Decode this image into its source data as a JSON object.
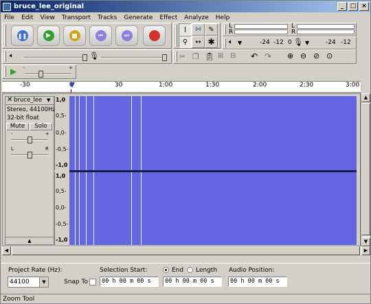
{
  "window": {
    "title": "bruce_lee_original"
  },
  "menu": [
    "File",
    "Edit",
    "View",
    "Transport",
    "Tracks",
    "Generate",
    "Effect",
    "Analyze",
    "Help"
  ],
  "meters": {
    "L": "L",
    "R": "R",
    "scale_a": "-24",
    "scale_b": "-12",
    "scale_c": "0",
    "scale_d": "-24",
    "scale_e": "-12"
  },
  "ruler": {
    "ticks": [
      "-30",
      "0",
      "30",
      "1:00",
      "1:30",
      "2:00",
      "2:30",
      "3:00"
    ]
  },
  "track": {
    "name": "bruce_lee",
    "info1": "Stereo, 44100Hz",
    "info2": "32-bit float",
    "mute": "Mute",
    "solo": "Solo",
    "gain_minus": "-",
    "gain_plus": "+",
    "pan_l": "L",
    "pan_r": "R",
    "scale": [
      "1,0",
      "0,5-",
      "0,0-",
      "-0,5-",
      "-1,0"
    ]
  },
  "bottom": {
    "project_rate_label": "Project Rate (Hz):",
    "project_rate_value": "44100",
    "snap_to": "Snap To",
    "selection_start_label": "Selection Start:",
    "end_label": "End",
    "length_label": "Length",
    "audio_position_label": "Audio Position:",
    "time_value": "00 h 00 m 00 s"
  },
  "status": "Zoom Tool"
}
